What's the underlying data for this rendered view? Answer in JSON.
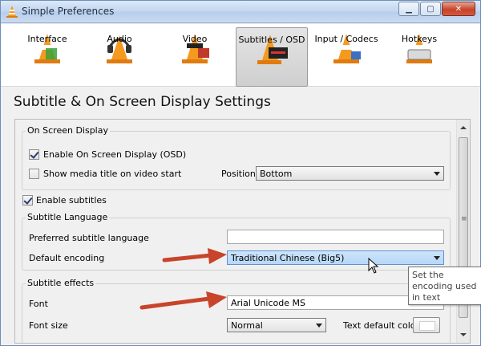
{
  "window": {
    "title": "Simple Preferences",
    "buttons": [
      "minimize",
      "maximize",
      "close"
    ]
  },
  "toolbar": {
    "items": [
      {
        "label": "Interface",
        "icon": "cone-interface-icon"
      },
      {
        "label": "Audio",
        "icon": "cone-audio-icon"
      },
      {
        "label": "Video",
        "icon": "cone-video-icon"
      },
      {
        "label": "Subtitles / OSD",
        "icon": "cone-subtitles-icon",
        "active": true
      },
      {
        "label": "Input / Codecs",
        "icon": "cone-codecs-icon"
      },
      {
        "label": "Hotkeys",
        "icon": "cone-hotkeys-icon"
      }
    ]
  },
  "heading": "Subtitle & On Screen Display Settings",
  "osd": {
    "group_title": "On Screen Display",
    "enable_osd_label": "Enable On Screen Display (OSD)",
    "enable_osd_checked": true,
    "show_title_label": "Show media title on video start",
    "show_title_checked": false,
    "position_label": "Position",
    "position_value": "Bottom"
  },
  "subtitles": {
    "enable_label": "Enable subtitles",
    "enable_checked": true,
    "language_group_title": "Subtitle Language",
    "preferred_label": "Preferred subtitle language",
    "preferred_value": "",
    "encoding_label": "Default encoding",
    "encoding_value": "Traditional Chinese (Big5)",
    "effects_group_title": "Subtitle effects",
    "font_label": "Font",
    "font_value": "Arial Unicode MS",
    "font_size_label": "Font size",
    "font_size_value": "Normal",
    "text_color_label": "Text default color"
  },
  "tooltip": "Set the encoding used in text subtitles",
  "colors": {
    "annotation_arrow": "#c8442a",
    "titlebar": "#c2d6ef"
  }
}
